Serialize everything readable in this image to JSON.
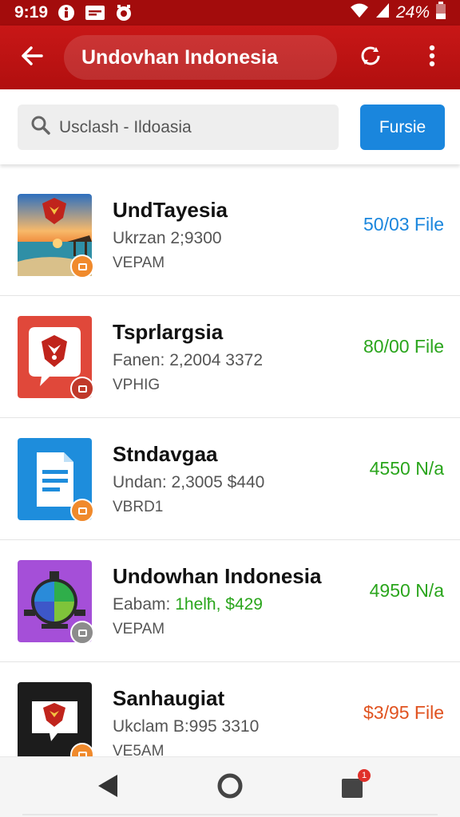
{
  "status_bar": {
    "time": "9:19",
    "battery": "24%",
    "icons": [
      "info-icon",
      "message-icon",
      "alarm-icon",
      "wifi-icon",
      "signal-icon",
      "battery-icon"
    ]
  },
  "app_bar": {
    "title": "Undovhan Indonesia",
    "icons": [
      "back-arrow-icon",
      "refresh-icon",
      "more-vert-icon"
    ]
  },
  "search": {
    "placeholder": "Usclash - Ildoasia",
    "button_label": "Fursie"
  },
  "items": [
    {
      "title": "UndTayesia",
      "meta": "Ukrzan 2;9300",
      "meta_highlight": "",
      "sub": "VEPAM",
      "price": "50/03 File",
      "price_color": "#1a86dd",
      "badge_color": "#f08a2c",
      "icon": "beach-emblem-icon"
    },
    {
      "title": "Tsprlargsia",
      "meta": "Fanen: 2,2004 3372",
      "meta_highlight": "",
      "sub": "VPHIG",
      "price": "80/00 File",
      "price_color": "#2aa51c",
      "badge_color": "#c0392b",
      "icon": "garuda-emblem-icon"
    },
    {
      "title": "Stndavgaa",
      "meta": "Undan: 2,3005 $440",
      "meta_highlight": "",
      "sub": "VBRD1",
      "price": "4550 N/a",
      "price_color": "#2aa51c",
      "badge_color": "#f08a2c",
      "icon": "document-icon"
    },
    {
      "title": "Undowhan Indonesia",
      "meta": "Eabam: ",
      "meta_highlight": "1helħ, $429",
      "sub": "VEPAM",
      "price": "4950 N/a",
      "price_color": "#2aa51c",
      "badge_color": "#8c8c8c",
      "icon": "globe-device-icon"
    },
    {
      "title": "Sanhaugiat",
      "meta": "Ukclam B:995 3310",
      "meta_highlight": "",
      "sub": "VE5AM",
      "price": "$3/95 File",
      "price_color": "#e0521f",
      "badge_color": "#f08a2c",
      "icon": "chat-emblem-icon"
    }
  ],
  "nav_bar": {
    "icons": [
      "nav-back-icon",
      "nav-home-icon",
      "nav-recents-icon"
    ],
    "recents_badge": "1"
  },
  "colors": {
    "primary": "#c81717",
    "status_bar": "#a30c0c",
    "accent_blue": "#1a86dd",
    "price_green": "#2aa51c",
    "price_orange": "#e0521f"
  }
}
